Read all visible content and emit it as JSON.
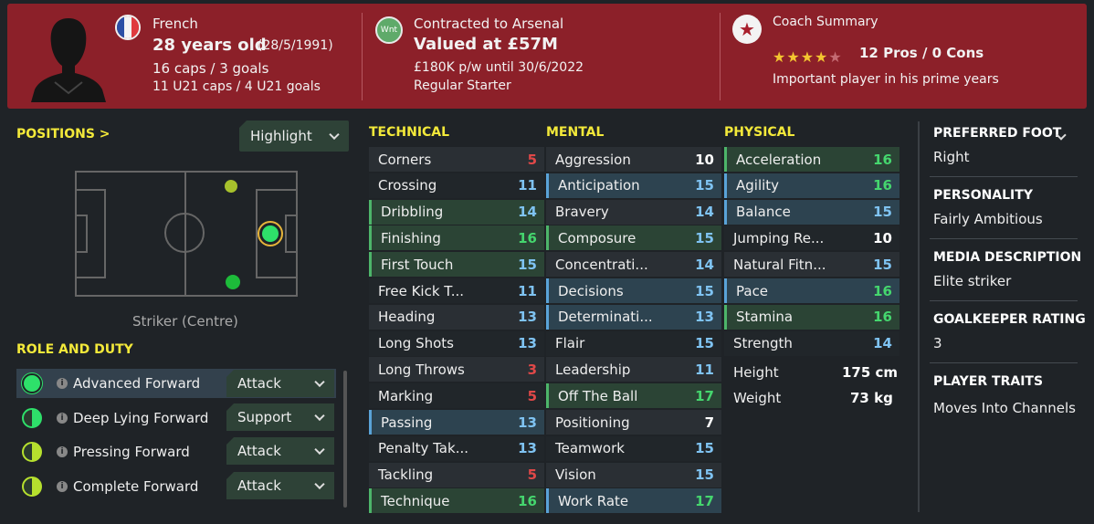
{
  "header": {
    "nationality": "French",
    "age": "28 years old",
    "dob": "(28/5/1991)",
    "caps": "16 caps / 3 goals",
    "u21": "11 U21 caps / 4 U21 goals",
    "contract_label": "Contracted to Arsenal",
    "value": "Valued at £57M",
    "wage": "£180K p/w until 30/6/2022",
    "status": "Regular Starter",
    "badge": "Wnt",
    "coach_title": "Coach Summary",
    "stars": 4,
    "stars_max": 5,
    "pros_cons": "12 Pros / 0 Cons",
    "coach_note": "Important player in his prime years"
  },
  "positions": {
    "title": "POSITIONS >",
    "highlight": "Highlight",
    "label": "Striker (Centre)"
  },
  "roles": {
    "title": "ROLE AND DUTY",
    "items": [
      {
        "name": "Advanced Forward",
        "duty": "Attack",
        "rating": 1.0
      },
      {
        "name": "Deep Lying Forward",
        "duty": "Support",
        "rating": 0.5
      },
      {
        "name": "Pressing Forward",
        "duty": "Attack",
        "rating": 0.5
      },
      {
        "name": "Complete Forward",
        "duty": "Attack",
        "rating": 0.5
      }
    ]
  },
  "technical": {
    "title": "TECHNICAL",
    "attrs": [
      {
        "name": "Corners",
        "value": "5"
      },
      {
        "name": "Crossing",
        "value": "11"
      },
      {
        "name": "Dribbling",
        "value": "14"
      },
      {
        "name": "Finishing",
        "value": "16"
      },
      {
        "name": "First Touch",
        "value": "15"
      },
      {
        "name": "Free Kick T...",
        "value": "11"
      },
      {
        "name": "Heading",
        "value": "13"
      },
      {
        "name": "Long Shots",
        "value": "13"
      },
      {
        "name": "Long Throws",
        "value": "3"
      },
      {
        "name": "Marking",
        "value": "5"
      },
      {
        "name": "Passing",
        "value": "13"
      },
      {
        "name": "Penalty Tak...",
        "value": "13"
      },
      {
        "name": "Tackling",
        "value": "5"
      },
      {
        "name": "Technique",
        "value": "16"
      }
    ]
  },
  "mental": {
    "title": "MENTAL",
    "attrs": [
      {
        "name": "Aggression",
        "value": "10"
      },
      {
        "name": "Anticipation",
        "value": "15"
      },
      {
        "name": "Bravery",
        "value": "14"
      },
      {
        "name": "Composure",
        "value": "15"
      },
      {
        "name": "Concentrati...",
        "value": "14"
      },
      {
        "name": "Decisions",
        "value": "15"
      },
      {
        "name": "Determinati...",
        "value": "13"
      },
      {
        "name": "Flair",
        "value": "15"
      },
      {
        "name": "Leadership",
        "value": "11"
      },
      {
        "name": "Off The Ball",
        "value": "17"
      },
      {
        "name": "Positioning",
        "value": "7"
      },
      {
        "name": "Teamwork",
        "value": "15"
      },
      {
        "name": "Vision",
        "value": "15"
      },
      {
        "name": "Work Rate",
        "value": "17"
      }
    ]
  },
  "physical": {
    "title": "PHYSICAL",
    "attrs": [
      {
        "name": "Acceleration",
        "value": "16"
      },
      {
        "name": "Agility",
        "value": "16"
      },
      {
        "name": "Balance",
        "value": "15"
      },
      {
        "name": "Jumping Re...",
        "value": "10"
      },
      {
        "name": "Natural Fitn...",
        "value": "15"
      },
      {
        "name": "Pace",
        "value": "16"
      },
      {
        "name": "Stamina",
        "value": "16"
      },
      {
        "name": "Strength",
        "value": "14"
      }
    ],
    "height_label": "Height",
    "height": "175 cm",
    "weight_label": "Weight",
    "weight": "73 kg"
  },
  "side": {
    "foot_label": "PREFERRED FOOT",
    "foot": "Right",
    "personality_label": "PERSONALITY",
    "personality": "Fairly Ambitious",
    "media_label": "MEDIA DESCRIPTION",
    "media": "Elite striker",
    "gk_label": "GOALKEEPER RATING",
    "gk": "3",
    "traits_label": "PLAYER TRAITS",
    "traits": "Moves Into Channels"
  },
  "colors": {
    "header_bg": "#8c2029",
    "accent_yellow": "#f3e93a",
    "attr_green": "#45d66e",
    "attr_blue": "#7fc3f2",
    "attr_red": "#e04848"
  }
}
